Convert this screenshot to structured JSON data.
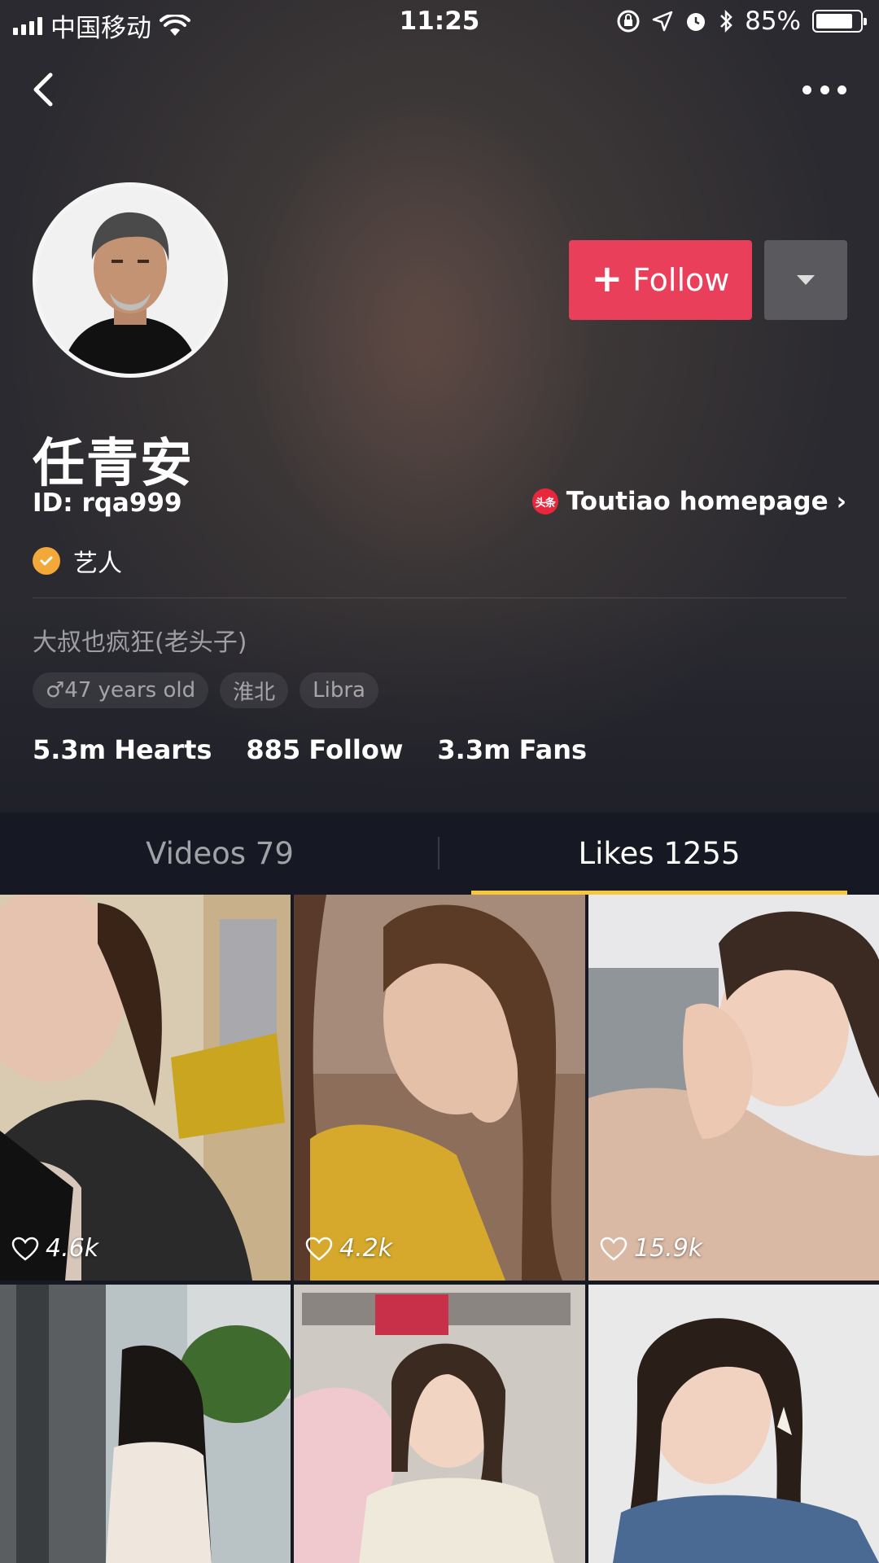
{
  "status_bar": {
    "carrier": "中国移动",
    "time": "11:25",
    "battery": "85%",
    "battery_level": 0.85
  },
  "profile": {
    "name": "任青安",
    "id_label": "ID: rqa999",
    "toutiao_badge": "头条",
    "toutiao_label": "Toutiao homepage",
    "verified_label": "艺人",
    "bio": "大叔也疯狂(老头子)",
    "tags": [
      "♂47 years old",
      "淮北",
      "Libra"
    ],
    "stats": [
      {
        "value": "5.3m",
        "label": "Hearts"
      },
      {
        "value": "885",
        "label": "Follow"
      },
      {
        "value": "3.3m",
        "label": "Fans"
      }
    ]
  },
  "actions": {
    "follow_label": "Follow"
  },
  "tabs": [
    {
      "label": "Videos 79",
      "active": false
    },
    {
      "label": "Likes 1255",
      "active": true
    }
  ],
  "colors": {
    "follow": "#ea3f5a",
    "tab_indicator": "#f6c63d",
    "verified": "#f2a93a"
  },
  "videos": [
    {
      "likes": "4.6k"
    },
    {
      "likes": "4.2k"
    },
    {
      "likes": "15.9k"
    },
    {
      "likes": ""
    },
    {
      "likes": ""
    },
    {
      "likes": ""
    }
  ]
}
